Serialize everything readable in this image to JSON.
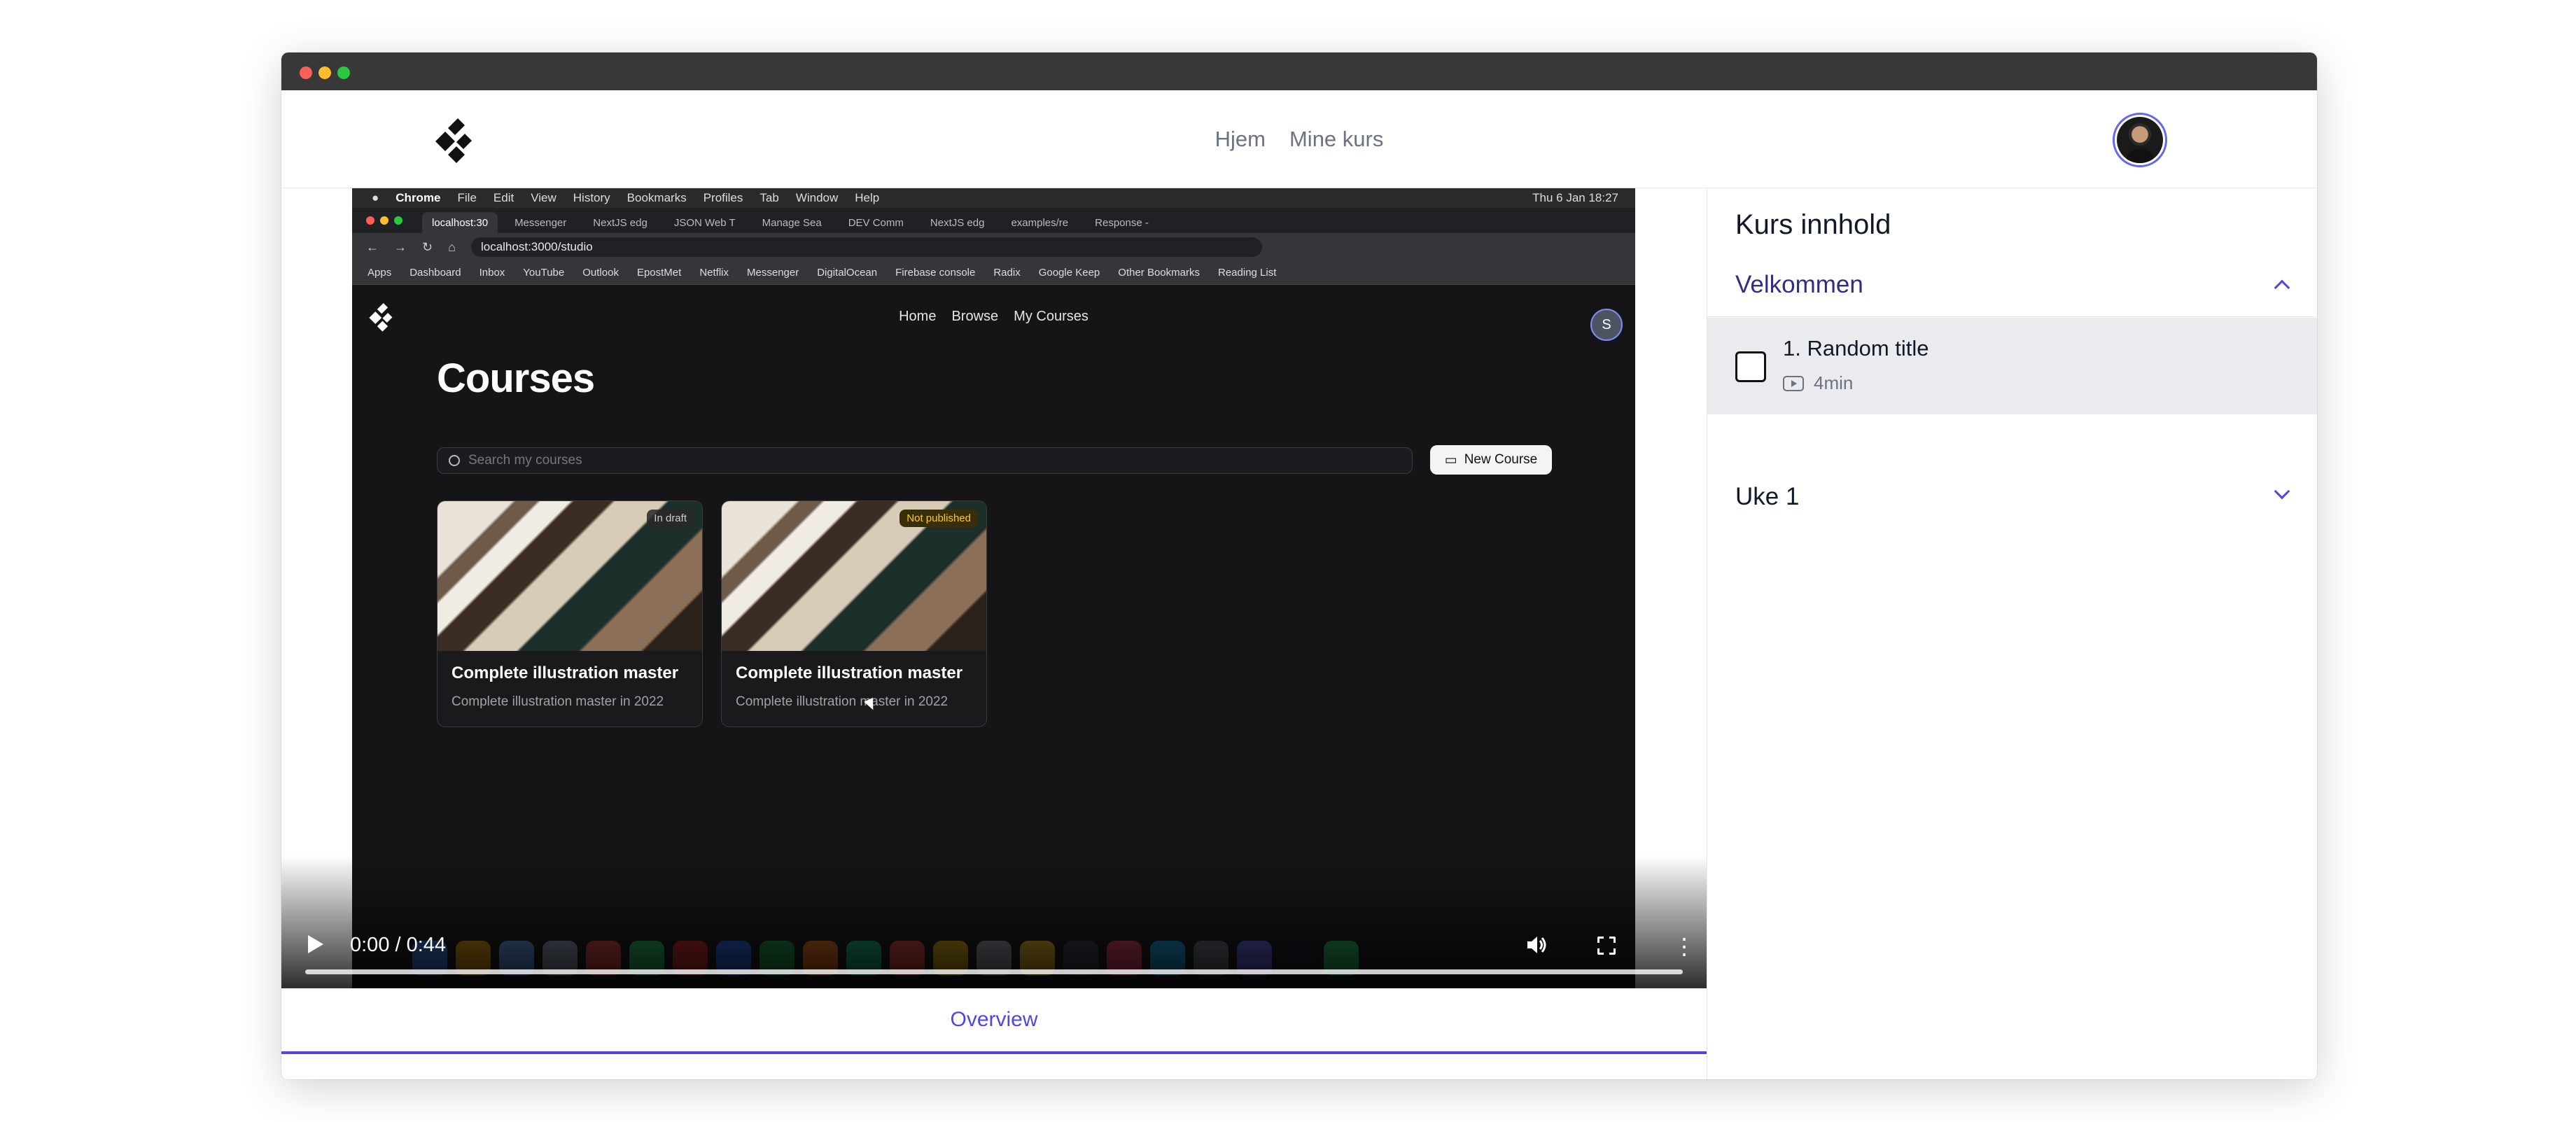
{
  "navbar": {
    "links": [
      "Hjem",
      "Mine kurs"
    ]
  },
  "video": {
    "time": "0:00 / 0:44",
    "progress": 0.0,
    "screen": {
      "menubar": [
        "Chrome",
        "File",
        "Edit",
        "View",
        "History",
        "Bookmarks",
        "Profiles",
        "Tab",
        "Window",
        "Help"
      ],
      "clock": "Thu 6 Jan  18:27",
      "tabs": [
        "localhost:30",
        "Messenger",
        "NextJS edg",
        "JSON Web T",
        "Manage Sea",
        "DEV Comm",
        "NextJS edg",
        "examples/re",
        "Response -"
      ],
      "url": "localhost:3000/studio",
      "bookmarks": [
        "Apps",
        "Dashboard",
        "Inbox",
        "YouTube",
        "Outlook",
        "EpostMet",
        "Netflix",
        "Messenger",
        "DigitalOcean",
        "Firebase console",
        "Radix",
        "Google Keep",
        "Other Bookmarks",
        "Reading List"
      ],
      "app_nav": [
        "Home",
        "Browse",
        "My Courses"
      ],
      "avatar_letter": "S",
      "page_title": "Courses",
      "search_placeholder": "Search my courses",
      "new_course": "New Course",
      "cards": [
        {
          "badge": "In draft",
          "title": "Complete illustration master",
          "subtitle": "Complete illustration master in 2022"
        },
        {
          "badge": "Not published",
          "title": "Complete illustration master",
          "subtitle": "Complete illustration master in 2022"
        }
      ]
    }
  },
  "tabs": {
    "overview": "Overview"
  },
  "sidebar": {
    "title": "Kurs innhold",
    "sections": [
      {
        "title": "Velkommen",
        "expanded": true,
        "lessons": [
          {
            "title": "1. Random title",
            "duration": "4min"
          }
        ]
      },
      {
        "title": "Uke 1",
        "expanded": false
      }
    ]
  },
  "colors": {
    "accent": "#4f46e5",
    "lesson_bg": "#e9ebee"
  }
}
